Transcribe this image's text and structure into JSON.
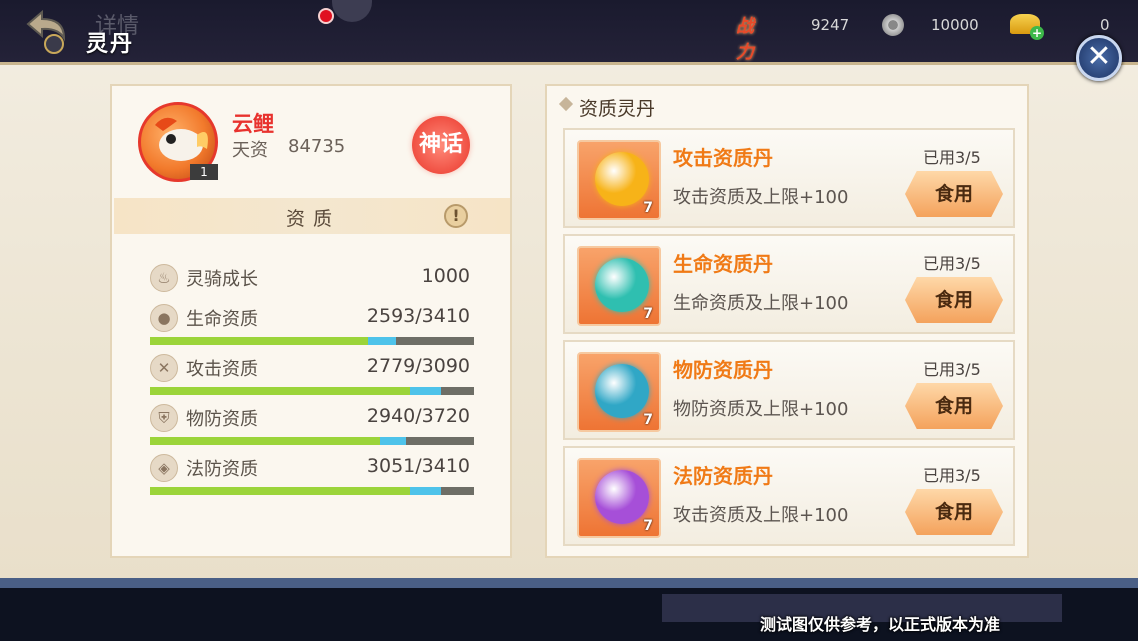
{
  "header": {
    "title": "灵丹",
    "ghost_tab": "详情",
    "power_label": "战力",
    "power_value": "9247",
    "coin_value": "10000",
    "gold_value": "0"
  },
  "pet": {
    "name": "云鲤",
    "talent_label": "天资",
    "talent_value": "84735",
    "level": "1",
    "rank": "神话"
  },
  "attributes": {
    "section_title": "资质",
    "info_icon": "!",
    "rows": [
      {
        "label": "灵骑成长",
        "value": "1000",
        "icon": "flame-icon",
        "has_bar": false
      },
      {
        "label": "生命资质",
        "value": "2593/3410",
        "icon": "gourd-icon",
        "has_bar": true,
        "fill": 0.674,
        "bonus": 0.086
      },
      {
        "label": "攻击资质",
        "value": "2779/3090",
        "icon": "swords-icon",
        "has_bar": true,
        "fill": 0.804,
        "bonus": 0.095
      },
      {
        "label": "物防资质",
        "value": "2940/3720",
        "icon": "shield-icon",
        "has_bar": true,
        "fill": 0.711,
        "bonus": 0.079
      },
      {
        "label": "法防资质",
        "value": "3051/3410",
        "icon": "magic-shield-icon",
        "has_bar": true,
        "fill": 0.804,
        "bonus": 0.095
      }
    ]
  },
  "pills": {
    "title": "资质灵丹",
    "items": [
      {
        "name": "攻击资质丹",
        "desc": "攻击资质及上限+100",
        "used": "已用3/5",
        "count": "7",
        "button": "食用",
        "color": "#f7b318"
      },
      {
        "name": "生命资质丹",
        "desc": "生命资质及上限+100",
        "used": "已用3/5",
        "count": "7",
        "button": "食用",
        "color": "#2fbfb0"
      },
      {
        "name": "物防资质丹",
        "desc": "物防资质及上限+100",
        "used": "已用3/5",
        "count": "7",
        "button": "食用",
        "color": "#30a7c6"
      },
      {
        "name": "法防资质丹",
        "desc": "攻击资质及上限+100",
        "used": "已用3/5",
        "count": "7",
        "button": "食用",
        "color": "#a64fd8"
      }
    ]
  },
  "footer": {
    "disclaimer": "测试图仅供参考，以正式版本为准"
  },
  "close_label": "✕"
}
